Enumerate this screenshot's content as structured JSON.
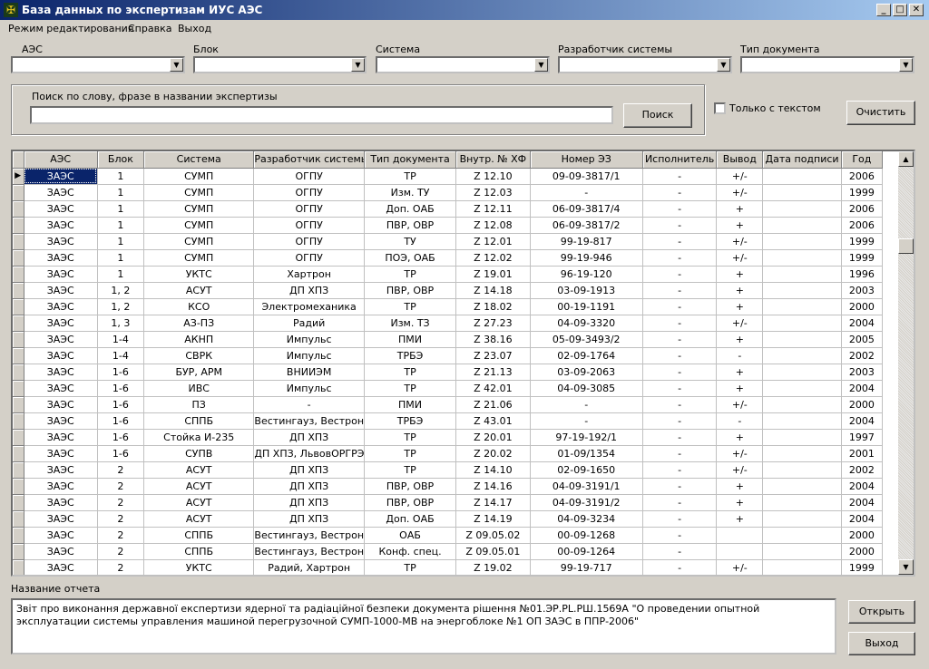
{
  "window": {
    "title": "База данных по экспертизам ИУС АЭС",
    "minimize": "_",
    "maximize": "□",
    "close": "✕"
  },
  "menu": [
    "Режим редактирования",
    "Справка",
    "Выход"
  ],
  "filters": {
    "aes_label": "АЭС",
    "block_label": "Блок",
    "system_label": "Система",
    "developer_label": "Разработчик системы",
    "doctype_label": "Тип документа"
  },
  "search": {
    "label": "Поиск по слову, фразе в названии экспертизы",
    "value": "",
    "button": "Поиск",
    "text_only_label": "Только с текстом",
    "clear_button": "Очистить"
  },
  "table": {
    "columns": [
      "АЭС",
      "Блок",
      "Система",
      "Разработчик системы",
      "Тип документа",
      "Внутр. № ХФ",
      "Номер ЭЗ",
      "Исполнитель",
      "Вывод",
      "Дата подписи",
      "Год"
    ],
    "rows": [
      [
        "ЗАЭС",
        "1",
        "СУМП",
        "ОГПУ",
        "ТР",
        "Z 12.10",
        "09-09-3817/1",
        "-",
        "+/-",
        "",
        "2006"
      ],
      [
        "ЗАЭС",
        "1",
        "СУМП",
        "ОГПУ",
        "Изм. ТУ",
        "Z 12.03",
        "-",
        "-",
        "+/-",
        "",
        "1999"
      ],
      [
        "ЗАЭС",
        "1",
        "СУМП",
        "ОГПУ",
        "Доп. ОАБ",
        "Z 12.11",
        "06-09-3817/4",
        "-",
        "+",
        "",
        "2006"
      ],
      [
        "ЗАЭС",
        "1",
        "СУМП",
        "ОГПУ",
        "ПВР, ОВР",
        "Z 12.08",
        "06-09-3817/2",
        "-",
        "+",
        "",
        "2006"
      ],
      [
        "ЗАЭС",
        "1",
        "СУМП",
        "ОГПУ",
        "ТУ",
        "Z 12.01",
        "99-19-817",
        "-",
        "+/-",
        "",
        "1999"
      ],
      [
        "ЗАЭС",
        "1",
        "СУМП",
        "ОГПУ",
        "ПОЭ, ОАБ",
        "Z 12.02",
        "99-19-946",
        "-",
        "+/-",
        "",
        "1999"
      ],
      [
        "ЗАЭС",
        "1",
        "УКТС",
        "Хартрон",
        "ТР",
        "Z 19.01",
        "96-19-120",
        "-",
        "+",
        "",
        "1996"
      ],
      [
        "ЗАЭС",
        "1, 2",
        "АСУТ",
        "ДП ХПЗ",
        "ПВР, ОВР",
        "Z 14.18",
        "03-09-1913",
        "-",
        "+",
        "",
        "2003"
      ],
      [
        "ЗАЭС",
        "1, 2",
        "КСО",
        "Электромеханика",
        "ТР",
        "Z 18.02",
        "00-19-1191",
        "-",
        "+",
        "",
        "2000"
      ],
      [
        "ЗАЭС",
        "1, 3",
        "АЗ-ПЗ",
        "Радий",
        "Изм. ТЗ",
        "Z 27.23",
        "04-09-3320",
        "-",
        "+/-",
        "",
        "2004"
      ],
      [
        "ЗАЭС",
        "1-4",
        "АКНП",
        "Импульс",
        "ПМИ",
        "Z 38.16",
        "05-09-3493/2",
        "-",
        "+",
        "",
        "2005"
      ],
      [
        "ЗАЭС",
        "1-4",
        "СВРК",
        "Импульс",
        "ТРБЭ",
        "Z 23.07",
        "02-09-1764",
        "-",
        "-",
        "",
        "2002"
      ],
      [
        "ЗАЭС",
        "1-6",
        "БУР, АРМ",
        "ВНИИЭМ",
        "ТР",
        "Z 21.13",
        "03-09-2063",
        "-",
        "+",
        "",
        "2003"
      ],
      [
        "ЗАЭС",
        "1-6",
        "ИВС",
        "Импульс",
        "ТР",
        "Z 42.01",
        "04-09-3085",
        "-",
        "+",
        "",
        "2004"
      ],
      [
        "ЗАЭС",
        "1-6",
        "ПЗ",
        "-",
        "ПМИ",
        "Z 21.06",
        "-",
        "-",
        "+/-",
        "",
        "2000"
      ],
      [
        "ЗАЭС",
        "1-6",
        "СППБ",
        "Вестингауз, Вестрон",
        "ТРБЭ",
        "Z 43.01",
        "-",
        "-",
        "-",
        "",
        "2004"
      ],
      [
        "ЗАЭС",
        "1-6",
        "Стойка И-235",
        "ДП ХПЗ",
        "ТР",
        "Z 20.01",
        "97-19-192/1",
        "-",
        "+",
        "",
        "1997"
      ],
      [
        "ЗАЭС",
        "1-6",
        "СУПВ",
        "ДП ХПЗ, ЛьвовОРГРЭС",
        "ТР",
        "Z 20.02",
        "01-09/1354",
        "-",
        "+/-",
        "",
        "2001"
      ],
      [
        "ЗАЭС",
        "2",
        "АСУТ",
        "ДП ХПЗ",
        "ТР",
        "Z 14.10",
        "02-09-1650",
        "-",
        "+/-",
        "",
        "2002"
      ],
      [
        "ЗАЭС",
        "2",
        "АСУТ",
        "ДП ХПЗ",
        "ПВР, ОВР",
        "Z 14.16",
        "04-09-3191/1",
        "-",
        "+",
        "",
        "2004"
      ],
      [
        "ЗАЭС",
        "2",
        "АСУТ",
        "ДП ХПЗ",
        "ПВР, ОВР",
        "Z 14.17",
        "04-09-3191/2",
        "-",
        "+",
        "",
        "2004"
      ],
      [
        "ЗАЭС",
        "2",
        "АСУТ",
        "ДП ХПЗ",
        "Доп. ОАБ",
        "Z 14.19",
        "04-09-3234",
        "-",
        "+",
        "",
        "2004"
      ],
      [
        "ЗАЭС",
        "2",
        "СППБ",
        "Вестингауз, Вестрон",
        "ОАБ",
        "Z 09.05.02",
        "00-09-1268",
        "-",
        "",
        "",
        "2000"
      ],
      [
        "ЗАЭС",
        "2",
        "СППБ",
        "Вестингауз, Вестрон",
        "Конф. спец.",
        "Z 09.05.01",
        "00-09-1264",
        "-",
        "",
        "",
        "2000"
      ],
      [
        "ЗАЭС",
        "2",
        "УКТС",
        "Радий, Хартрон",
        "ТР",
        "Z 19.02",
        "99-19-717",
        "-",
        "+/-",
        "",
        "1999"
      ]
    ]
  },
  "report": {
    "label": "Название отчета",
    "text": "Звіт про виконання державної експертизи ядерної та радіаційної безпеки документа рішення №01.ЭР.PL.РШ.1569А \"О проведении опытной эксплуатации системы управления машиной перегрузочной СУМП-1000-МВ на энергоблоке №1 ОП ЗАЭС в ППР-2006\"",
    "open_button": "Открыть",
    "exit_button": "Выход"
  }
}
